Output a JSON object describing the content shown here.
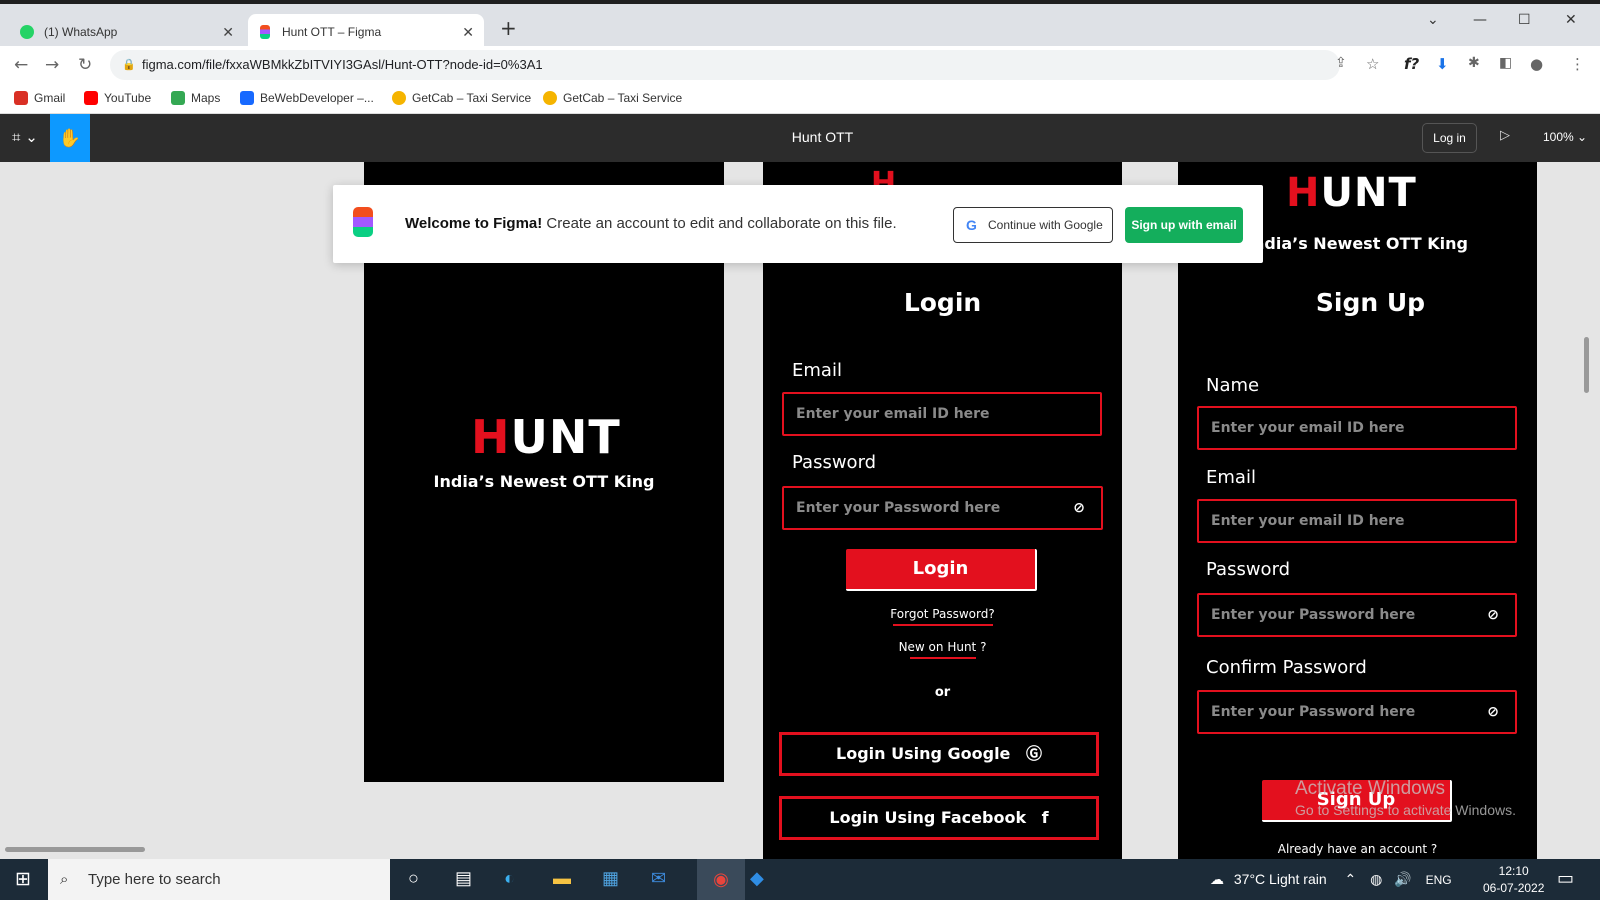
{
  "browser": {
    "tabs": [
      {
        "label": "(1) WhatsApp",
        "icon": "whatsapp-icon"
      },
      {
        "label": "Hunt OTT – Figma",
        "icon": "figma-icon"
      }
    ],
    "url": "figma.com/file/fxxaWBMkkZbITVIYI3GAsl/Hunt-OTT?node-id=0%3A1",
    "bookmarks": [
      {
        "label": "Gmail",
        "color": "#d93025"
      },
      {
        "label": "YouTube",
        "color": "#ff0000"
      },
      {
        "label": "Maps",
        "color": "#34a853"
      },
      {
        "label": "BeWebDeveloper –...",
        "color": "#1769ff"
      },
      {
        "label": "GetCab – Taxi Service",
        "color": "#f5b400"
      },
      {
        "label": "GetCab – Taxi Service",
        "color": "#f5b400"
      }
    ]
  },
  "figma": {
    "file_title": "Hunt OTT",
    "login_label": "Log in",
    "zoom": "100%",
    "welcome": {
      "bold": "Welcome to Figma!",
      "text": " Create an account to edit and collaborate on this file.",
      "google_label": "Continue with Google",
      "email_label": "Sign up with email"
    }
  },
  "design": {
    "brand": {
      "logo_first": "H",
      "logo_rest": "UNT",
      "tagline": "India’s Newest OTT King",
      "accent": "#e3101e"
    },
    "login": {
      "title": "Login",
      "email_label": "Email",
      "email_placeholder": "Enter your email ID here",
      "password_label": "Password",
      "password_placeholder": "Enter your Password here",
      "button": "Login",
      "forgot": "Forgot Password?",
      "new": "New on Hunt ?",
      "or": "or",
      "google": "Login Using Google",
      "facebook": "Login Using Facebook"
    },
    "signup": {
      "tagline_partial": "ndia’s Newest OTT King",
      "title": "Sign Up",
      "name_label": "Name",
      "name_placeholder": "Enter your email ID here",
      "email_label": "Email",
      "email_placeholder": "Enter your email ID here",
      "password_label": "Password",
      "password_placeholder": "Enter your Password here",
      "confirm_label": "Confirm Password",
      "confirm_placeholder": "Enter your Password here",
      "button": "Sign Up",
      "already": "Already have an account ?"
    }
  },
  "watermark": {
    "line1": "Activate Windows",
    "line2": "Go to Settings to activate Windows."
  },
  "taskbar": {
    "search_placeholder": "Type here to search",
    "weather": "37°C  Light rain",
    "lang": "ENG",
    "time": "12:10",
    "date": "06-07-2022"
  }
}
